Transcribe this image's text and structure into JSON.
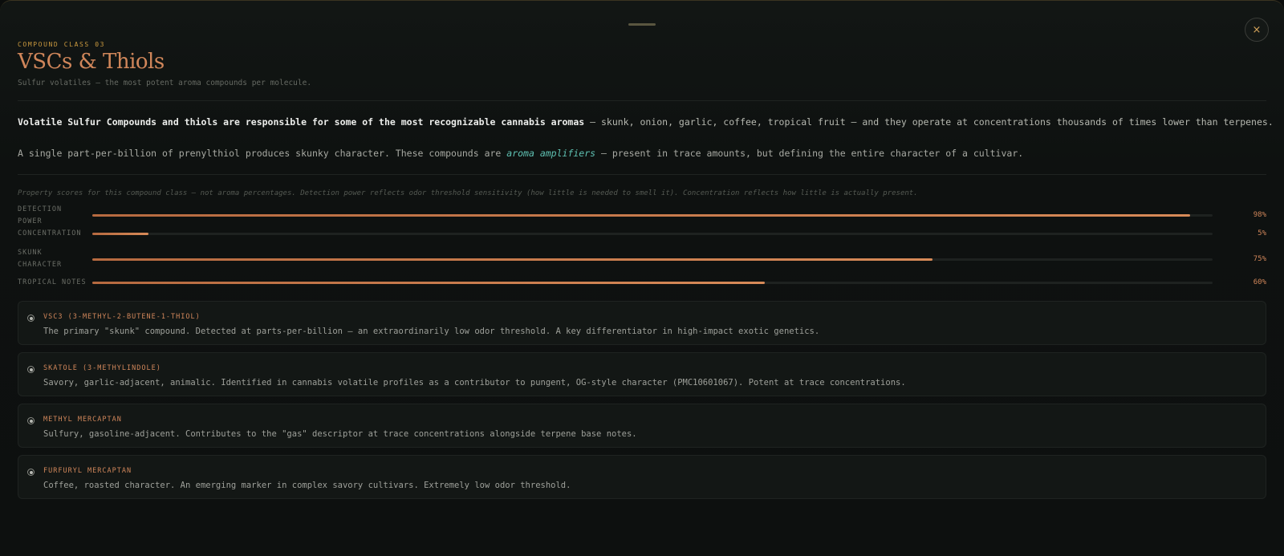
{
  "header": {
    "eyebrow": "COMPOUND CLASS 03",
    "title": "VSCs & Thiols",
    "subtitle": "Sulfur volatiles — the most potent aroma compounds per molecule.",
    "close_label": "×"
  },
  "intro": {
    "p1_bold": "Volatile Sulfur Compounds and thiols are responsible for some of the most recognizable cannabis aromas",
    "p1_rest": " — skunk, onion, garlic, coffee, tropical fruit — and they operate at concentrations thousands of times lower than terpenes.",
    "p2_start": "A single part-per-billion of prenylthiol produces skunky character. These compounds are ",
    "p2_highlight": "aroma amplifiers",
    "p2_end": " — present in trace amounts, but defining the entire character of a cultivar."
  },
  "note": "Property scores for this compound class — not aroma percentages. Detection power reflects odor threshold sensitivity (how little is needed to smell it). Concentration reflects how little is actually present.",
  "properties": [
    {
      "label": "DETECTION POWER",
      "value": 98,
      "display": "98%"
    },
    {
      "label": "CONCENTRATION",
      "value": 5,
      "display": "5%"
    },
    {
      "label": "SKUNK CHARACTER",
      "value": 75,
      "display": "75%"
    },
    {
      "label": "TROPICAL NOTES",
      "value": 60,
      "display": "60%"
    }
  ],
  "compounds": [
    {
      "name": "VSC3 (3-METHYL-2-BUTENE-1-THIOL)",
      "desc": "The primary \"skunk\" compound. Detected at parts-per-billion — an extraordinarily low odor threshold. A key differentiator in high-impact exotic genetics."
    },
    {
      "name": "SKATOLE (3-METHYLINDOLE)",
      "desc": "Savory, garlic-adjacent, animalic. Identified in cannabis volatile profiles as a contributor to pungent, OG-style character (PMC10601067). Potent at trace concentrations."
    },
    {
      "name": "METHYL MERCAPTAN",
      "desc": "Sulfury, gasoline-adjacent. Contributes to the \"gas\" descriptor at trace concentrations alongside terpene base notes."
    },
    {
      "name": "FURFURYL MERCAPTAN",
      "desc": "Coffee, roasted character. An emerging marker in complex savory cultivars. Extremely low odor threshold."
    }
  ],
  "colors": {
    "accent": "#d0865a",
    "eyebrow": "#c9983f",
    "highlight": "#5fc2b3"
  }
}
